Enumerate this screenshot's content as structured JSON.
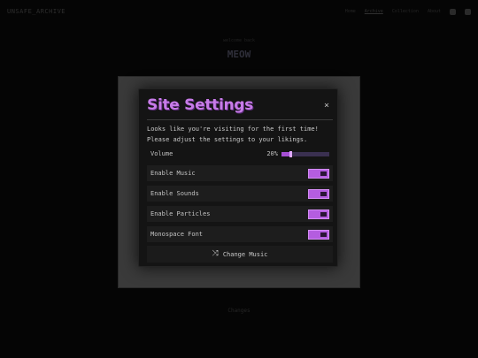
{
  "background": {
    "brand": "UNSAFE_ARCHIVE",
    "nav": [
      "Home",
      "Archive",
      "Collection",
      "About"
    ],
    "small_heading": "welcome back",
    "title": "MEOW",
    "footer": "Changes"
  },
  "modal": {
    "title": "Site Settings",
    "close_label": "×",
    "intro_line1": "Looks like you're visiting for the first time!",
    "intro_line2": "Please adjust the settings to your likings.",
    "volume": {
      "label": "Volume",
      "value_text": "20%",
      "level": 0.2
    },
    "toggles": [
      {
        "label": "Enable Music",
        "on": true
      },
      {
        "label": "Enable Sounds",
        "on": true
      },
      {
        "label": "Enable Particles",
        "on": true
      },
      {
        "label": "Monospace Font",
        "on": true
      }
    ],
    "change_music_label": "Change Music",
    "change_music_icon": "shuffle-icon"
  },
  "colors": {
    "accent": "#b45de0",
    "title": "#c77be8",
    "panel": "#141414"
  }
}
